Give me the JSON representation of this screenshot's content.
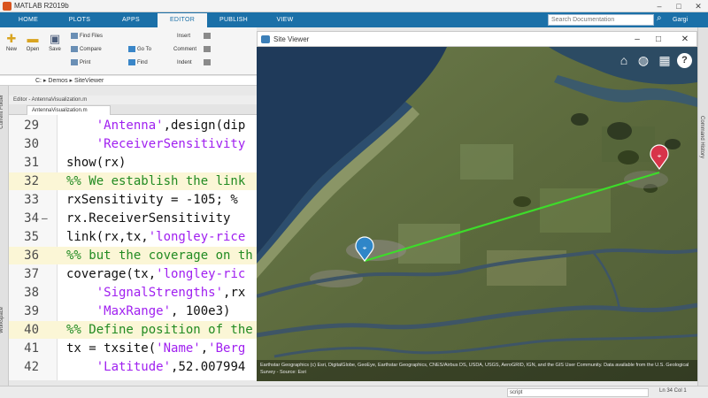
{
  "window": {
    "title": "MATLAB R2019b",
    "user": "Gargi"
  },
  "ribbon_tabs": [
    "HOME",
    "PLOTS",
    "APPS",
    "EDITOR",
    "PUBLISH",
    "VIEW"
  ],
  "search_placeholder": "Search Documentation",
  "ribbon": {
    "new": "New",
    "open": "Open",
    "save": "Save",
    "find_files": "Find Files",
    "compare": "Compare",
    "print": "Print",
    "go_to": "Go To",
    "find": "Find",
    "insert": "Insert",
    "comment": "Comment",
    "indent": "Indent"
  },
  "address_path": "C: ▸ Demos ▸ SiteViewer",
  "editor_title": "Editor - AntennaVisualization.m",
  "file_tab": "AntennaVisualization.m",
  "code_lines": [
    {
      "n": "29",
      "parts": [
        {
          "t": "    ",
          "c": ""
        },
        {
          "t": "'Antenna'",
          "c": "str"
        },
        {
          "t": ",design(dip",
          "c": ""
        }
      ]
    },
    {
      "n": "30",
      "parts": [
        {
          "t": "    ",
          "c": ""
        },
        {
          "t": "'ReceiverSensitivity",
          "c": "str"
        }
      ]
    },
    {
      "n": "31",
      "parts": [
        {
          "t": "show(rx)",
          "c": ""
        }
      ]
    },
    {
      "n": "32",
      "hl": true,
      "parts": [
        {
          "t": "%% We establish the link",
          "c": "cmt"
        }
      ]
    },
    {
      "n": "33",
      "parts": [
        {
          "t": "rxSensitivity = -105; % ",
          "c": ""
        }
      ]
    },
    {
      "n": "34",
      "mark": "—",
      "parts": [
        {
          "t": "rx.ReceiverSensitivity",
          "c": ""
        }
      ]
    },
    {
      "n": "35",
      "parts": [
        {
          "t": "link(rx,tx,",
          "c": ""
        },
        {
          "t": "'longley-rice",
          "c": "str"
        }
      ]
    },
    {
      "n": "36",
      "hl": true,
      "parts": [
        {
          "t": "%% but the coverage on th",
          "c": "cmt"
        }
      ]
    },
    {
      "n": "37",
      "parts": [
        {
          "t": "coverage(tx,",
          "c": ""
        },
        {
          "t": "'longley-ric",
          "c": "str"
        }
      ]
    },
    {
      "n": "38",
      "parts": [
        {
          "t": "    ",
          "c": ""
        },
        {
          "t": "'SignalStrengths'",
          "c": "str"
        },
        {
          "t": ",rx",
          "c": ""
        }
      ]
    },
    {
      "n": "39",
      "parts": [
        {
          "t": "    ",
          "c": ""
        },
        {
          "t": "'MaxRange'",
          "c": "str"
        },
        {
          "t": ", 100e3)",
          "c": ""
        }
      ]
    },
    {
      "n": "40",
      "hl": true,
      "parts": [
        {
          "t": "%% Define position of the",
          "c": "cmt"
        }
      ]
    },
    {
      "n": "41",
      "parts": [
        {
          "t": "tx = txsite(",
          "c": ""
        },
        {
          "t": "'Name'",
          "c": "str"
        },
        {
          "t": ",",
          "c": ""
        },
        {
          "t": "'Berg",
          "c": "str"
        }
      ]
    },
    {
      "n": "42",
      "parts": [
        {
          "t": "    ",
          "c": ""
        },
        {
          "t": "'Latitude'",
          "c": "str"
        },
        {
          "t": ",52.007994",
          "c": ""
        }
      ]
    }
  ],
  "site_viewer": {
    "title": "Site Viewer",
    "attribution": "Earthstar Geographics (c) Esri, DigitalGlobe, GeoEye, Earthstar Geographics, CNES/Airbus DS, USDA, USGS, AeroGRID, IGN, and the GIS User Community. Data available from the U.S. Geological Survey - Source: Esri",
    "link_color": "#3ddc2a",
    "tx_color": "#2f86c8",
    "rx_color": "#d8344a"
  },
  "status": {
    "input": "script",
    "position": "Ln 34  Col 1"
  }
}
